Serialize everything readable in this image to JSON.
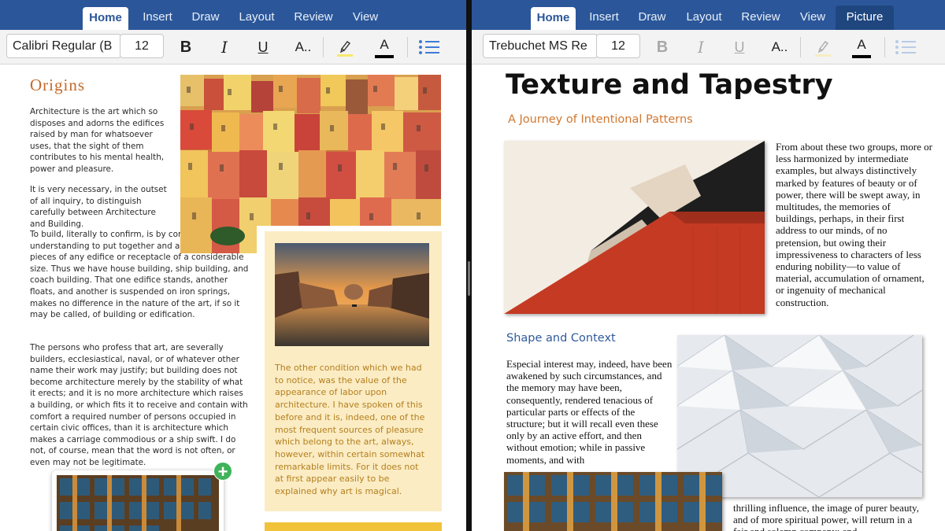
{
  "left_pane": {
    "tabs": [
      "Home",
      "Insert",
      "Draw",
      "Layout",
      "Review",
      "View"
    ],
    "active_tab": "Home",
    "font_name": "Calibri Regular (B",
    "font_size": "12",
    "bold_icon": "B",
    "italic_icon": "I",
    "underline_icon": "U",
    "text_effects_icon": "A..",
    "font_color_icon": "A",
    "title": "Origins",
    "paragraphs": [
      "Architecture is the art which so disposes and adorns the edifices raised by man for whatsoever uses, that the sight of them contributes to his mental health, power and pleasure.",
      "It is very necessary, in the outset of all inquiry, to distinguish carefully between Architecture and Building.",
      "To build, literally to confirm, is by common understanding to put together and adjust the several pieces of any edifice or receptacle of a considerable size. Thus we have house building, ship building, and coach building. That one edifice stands, another floats, and another is suspended on iron springs, makes no difference in the nature of the art, if so it may be called, of building or edification.",
      "The persons who profess that art, are severally builders, ecclesiastical, naval, or of whatever other name their work may justify; but building does not become architecture merely by the stability of what it erects; and it is no more architecture which raises a building, or which fits it to receive and contain with comfort a required number of persons occupied in certain civic offices, than it is architecture which makes a carriage commodious or a ship swift. I do not, of course, mean that the word is not often, or even may not be legitimate."
    ],
    "sidebar_text": "The other condition which we had to notice, was the value of the appearance of labor upon architecture. I have spoken of this before and it is, indeed, one of the most frequent sources of pleasure which belong to the art, always, however, within certain somewhat remarkable limits. For it does not at first appear easily to be explained why art is magical.",
    "add_button": "+"
  },
  "right_pane": {
    "tabs": [
      "Home",
      "Insert",
      "Draw",
      "Layout",
      "Review",
      "View",
      "Picture"
    ],
    "active_tab": "Home",
    "contextual_tab": "Picture",
    "font_name": "Trebuchet MS Re",
    "font_size": "12",
    "bold_icon": "B",
    "italic_icon": "I",
    "underline_icon": "U",
    "text_effects_icon": "A..",
    "font_color_icon": "A",
    "title": "Texture and Tapestry",
    "subtitle": "A Journey of Intentional Patterns",
    "paragraph_1": "From about these two groups, more or less harmonized by intermediate examples, but always distinctively marked by features of beauty or of power, there will be swept away, in multitudes, the memories of buildings, perhaps, in their first address to our minds, of no pretension, but owing their impressiveness to characters of less enduring nobility—to value of material, accumulation of ornament, or ingenuity of mechanical construction.",
    "section_heading": "Shape and Context",
    "paragraph_2": "Especial interest may, indeed, have been awakened by such circumstances, and the memory may have been, consequently, rendered tenacious of particular parts or effects of the structure; but it will recall even these only by an active effort, and then without emotion; while in passive moments, and with",
    "paragraph_3": "thrilling influence, the image of purer beauty, and of more spiritual power, will return in a fair and solemn company; and"
  },
  "colors": {
    "ribbon": "#2b579a",
    "origins_title": "#c46a2a",
    "sidebar_bg": "#fbecc4",
    "sidebar_text": "#b47f1d",
    "subtitle": "#d1772f",
    "section_heading": "#2f5a9c"
  }
}
